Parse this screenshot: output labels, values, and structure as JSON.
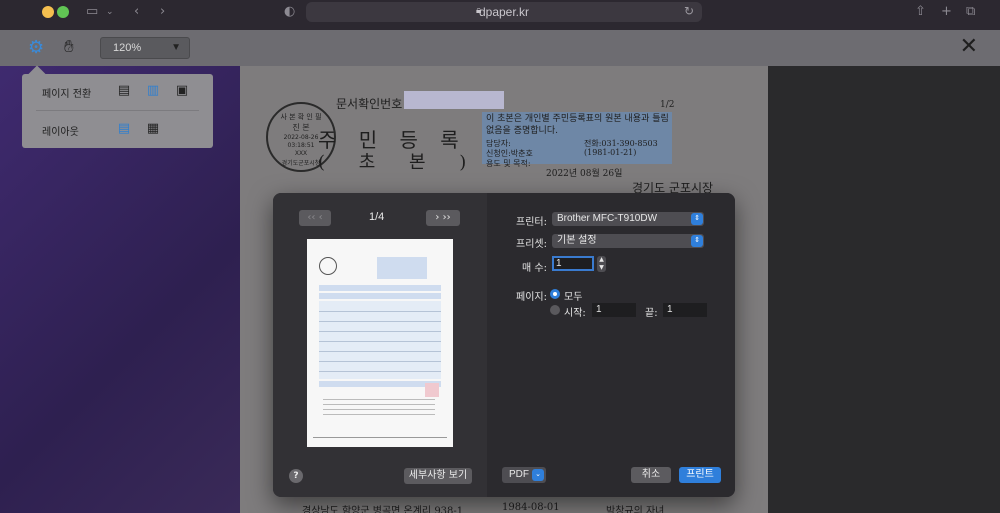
{
  "browser": {
    "url": "dpaper.kr"
  },
  "toolbar": {
    "zoom": "120%",
    "icons": [
      "gear-icon",
      "hand-icon",
      "close-icon"
    ]
  },
  "popover": {
    "page_transition_label": "페이지 전환",
    "layout_label": "레이아웃"
  },
  "document": {
    "confirm_label": "문서확인번호 :",
    "page_num": "1/2",
    "title": "주 민 등 록 표",
    "subtitle": "( 초   본 )",
    "seal": {
      "line1": "사 본 확 인 필",
      "line2": "진  본",
      "line3": "2022-08-26",
      "line4": "03:18:51",
      "line5": "XXX",
      "line6": "경기도군포시청"
    },
    "cert_text": "이 초본은 개인별 주민등록표의 원본 내용과 틀림없음을 증명합니다.",
    "rows": [
      {
        "label": "담당자:",
        "value": "전화:031-390-8503"
      },
      {
        "label": "신청인:박춘호",
        "value": "(1981-01-21)"
      },
      {
        "label": "용도 및 목적:",
        "value": ""
      }
    ],
    "date": "2022년 08월 26일",
    "office": "경기도 군포시장",
    "bottom_left": "경상남도 함양군 병곡면 온계리 938-1",
    "bottom_mid": "1984-08-01",
    "bottom_right": "박창규의 자녀"
  },
  "print_dialog": {
    "page_indicator": "1/4",
    "details_button": "세부사항 보기",
    "help_button": "?",
    "printer_label": "프린터:",
    "printer_value": "Brother MFC-T910DW",
    "preset_label": "프리셋:",
    "preset_value": "기본 설정",
    "copies_label": "매 수:",
    "copies_value": "1",
    "pages_label": "페이지:",
    "pages_all": "모두",
    "pages_from_label": "시작:",
    "pages_from_value": "1",
    "pages_to_label": "끝:",
    "pages_to_value": "1",
    "pdf_button": "PDF",
    "cancel_button": "취소",
    "print_button": "프린트"
  }
}
